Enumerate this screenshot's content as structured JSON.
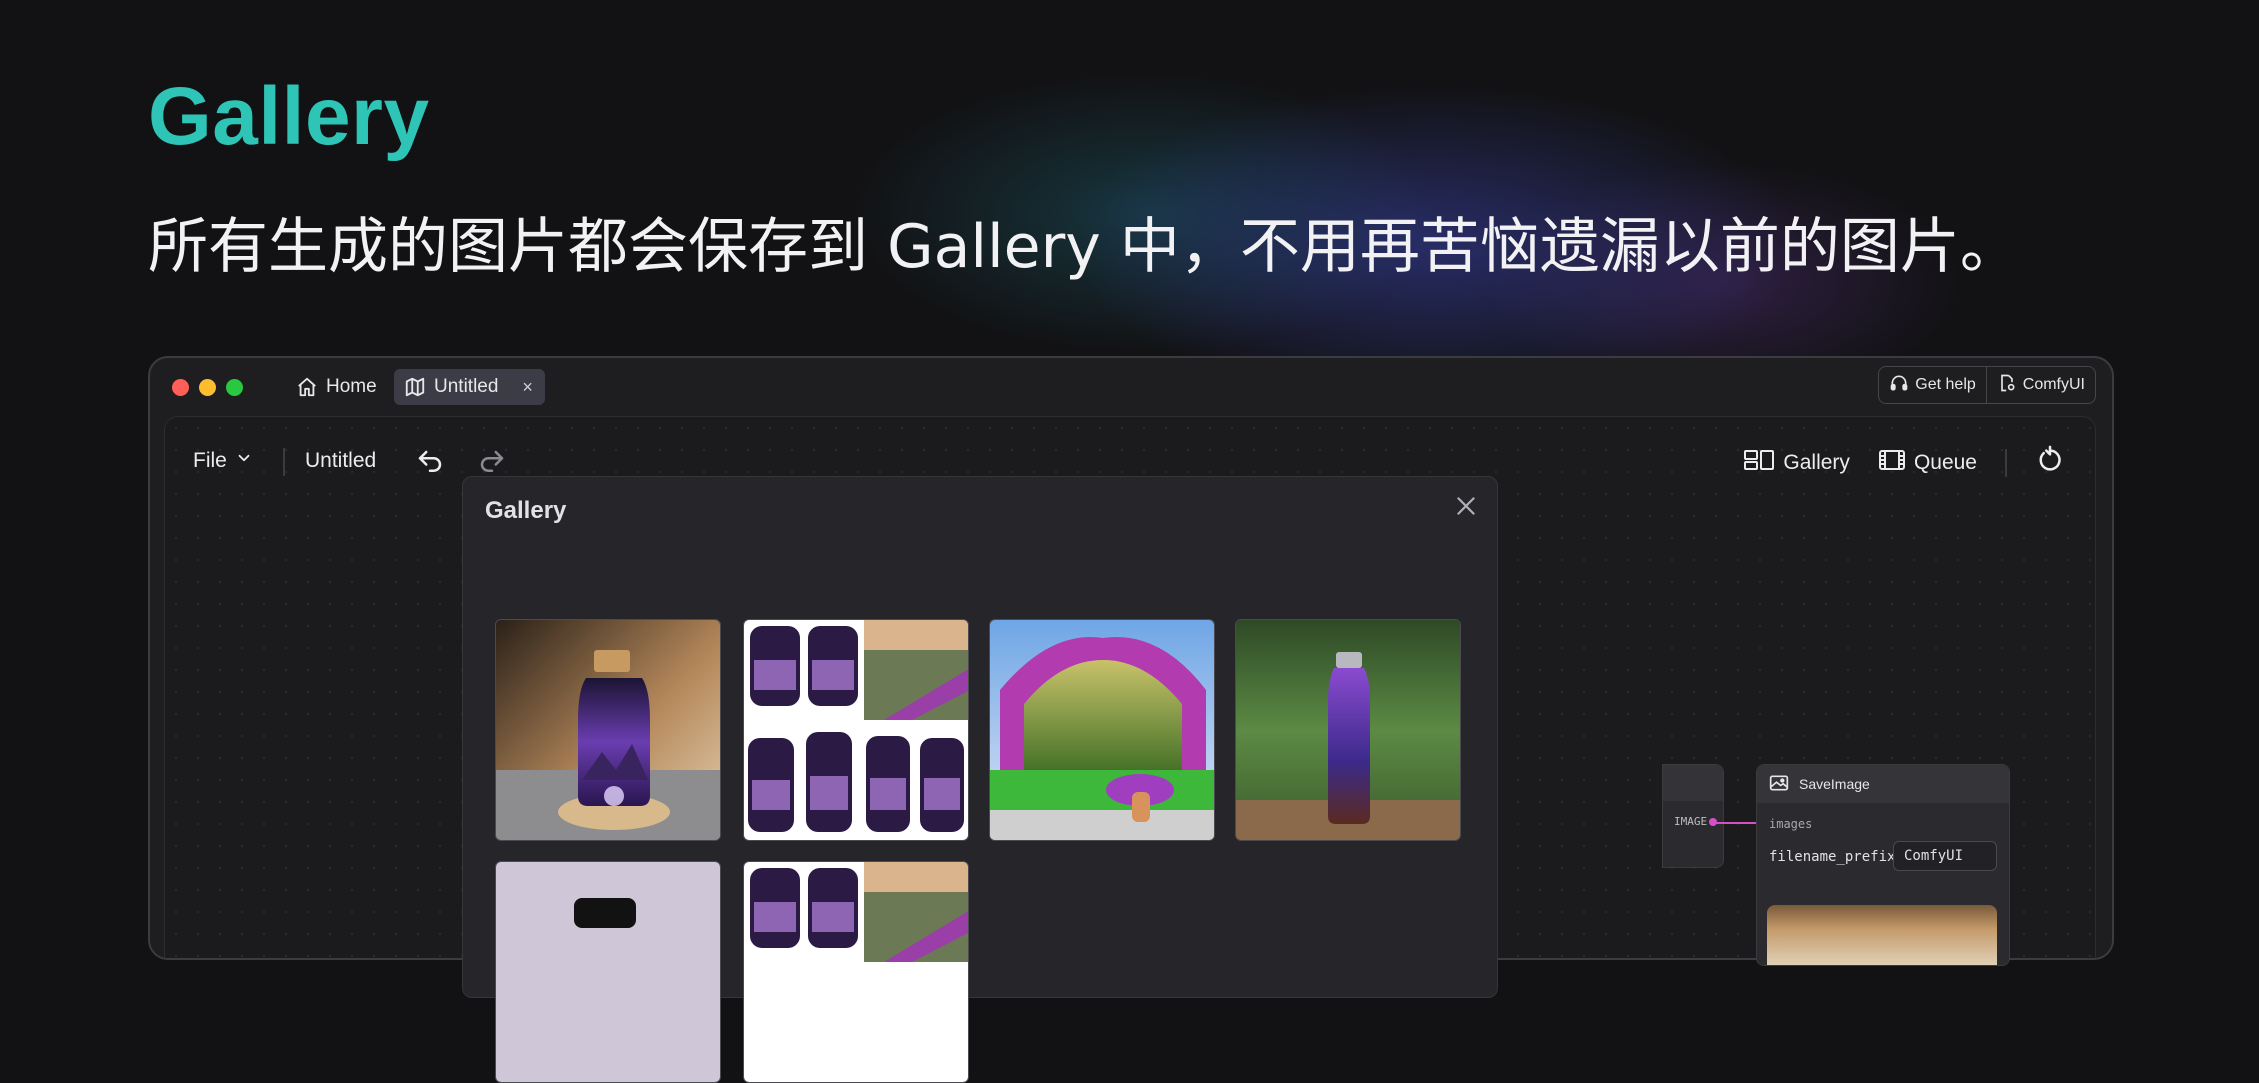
{
  "hero": {
    "title": "Gallery",
    "subtitle": "所有生成的图片都会保存到 Gallery 中，不用再苦恼遗漏以前的图片。"
  },
  "titlebar": {
    "tabs": [
      {
        "label": "Home",
        "icon": "home-icon"
      },
      {
        "label": "Untitled",
        "icon": "map-icon",
        "active": true
      }
    ],
    "close_glyph": "×",
    "help_label": "Get help",
    "comfy_label": "ComfyUI"
  },
  "toolbar": {
    "file_label": "File",
    "doc_title": "Untitled",
    "gallery_label": "Gallery",
    "queue_label": "Queue"
  },
  "gallery": {
    "title": "Gallery",
    "thumbnails": [
      "purple-galaxy-bottle-on-wood",
      "collage-of-night-sky-jars",
      "purple-tree-arch-forest-scene",
      "galaxy-bottle-in-forest",
      "bottle-with-black-cap",
      "collage-of-night-sky-jars"
    ]
  },
  "nodes": {
    "output_type": "IMAGE",
    "save_title": "SaveImage",
    "input_label": "images",
    "filename_prefix_label": "filename_prefix",
    "filename_prefix_value": "ComfyUI"
  },
  "colors": {
    "accent": "#2ec4b6",
    "link": "#d44fc8",
    "background": "#121214"
  }
}
